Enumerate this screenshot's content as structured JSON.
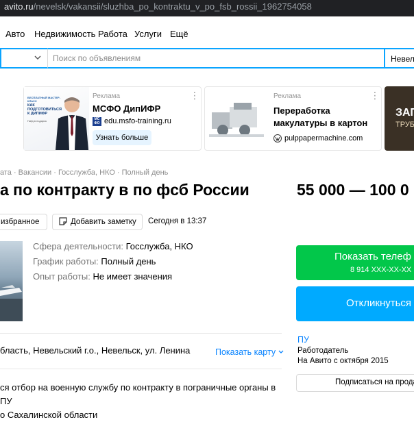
{
  "browser": {
    "url_host": "avito.ru",
    "url_path": "/nevelsk/vakansii/sluzhba_po_kontraktu_v_po_fsb_rossii_1962754058"
  },
  "nav": {
    "items": [
      "Авто",
      "Недвижимость",
      "Работа",
      "Услуги",
      "Ещё"
    ]
  },
  "search": {
    "placeholder": "Поиск по объявлениям",
    "city": "Невель"
  },
  "ads": [
    {
      "label": "Реклама",
      "title": "МСФО ДипИФР",
      "domain": "edu.msfo-training.ru",
      "button": "Узнать больше",
      "logo_text": "МС ФО",
      "img_header": "БЕСПЛАТНЫЙ МАСТЕР-КЛАСС",
      "img_headline": "КАК ПОДГОТОВИТЬСЯ К ДИПИФР",
      "img_sub": "Гайд в подарок"
    },
    {
      "label": "Реклама",
      "title": "Переработка макулатуры в картон",
      "domain": "pulppapermachine.com"
    },
    {
      "img_text_1": "ЗАП",
      "img_text_2": "ТРУБ"
    }
  ],
  "breadcrumb": "ата · Вакансии · Госслужба, НКО · Полный день",
  "listing": {
    "title": "а по контракту в по фсб России",
    "price": "55 000 — 100 0",
    "favorite_label": "избранное",
    "note_label": "Добавить заметку",
    "date_posted": "Сегодня в 13:37",
    "fields": [
      {
        "key": "Сфера деятельности:",
        "value": "Госслужба, НКО"
      },
      {
        "key": "График работы:",
        "value": "Полный день"
      },
      {
        "key": "Опыт работы:",
        "value": "Не имеет значения"
      }
    ],
    "address": "бласть, Невельский г.о., Невельск, ул. Ленина",
    "map_link": "Показать карту",
    "description_lines": [
      "ся отбор на военную службу по контракту в пограничные органы в ПУ",
      "о Сахалинской области"
    ]
  },
  "contact": {
    "phone_button": "Показать телеф",
    "phone_masked": "8 914 XXX-XX-XX",
    "respond_button": "Откликнуться",
    "seller_name": "ПУ",
    "seller_role": "Работодатель",
    "seller_since": "На Авито с октября 2015",
    "subscribe_button": "Подписаться на прода"
  },
  "colors": {
    "accent": "#00aaff",
    "green": "#02c74a",
    "link": "#0a84ff"
  }
}
